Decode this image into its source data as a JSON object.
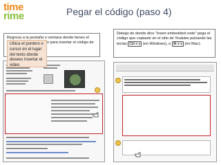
{
  "logo": {
    "line1": "time",
    "line2": "rime"
  },
  "slide": {
    "title": "Pegar el código (paso 4)"
  },
  "instructions": {
    "left": "Regresa a la pestaña o ventana donde tienes el sitio de Timerime abierto para insertar el código de Youtube,",
    "right_part1": "Debajo de donde dice “Insert embedded code” pega el código que copiaste en el sitio de Youtube pulsando las teclas",
    "right_keys_win": "Ctrl + v",
    "right_part2": "(en Windows), o",
    "right_keys_mac": "⌘ + v",
    "right_part3": "(en Mac)."
  },
  "callout": {
    "text": "Ubica el puntero o cursor en el lugar del texto donde desees insertar el video"
  },
  "badges": {
    "left": "1",
    "right_top": "2",
    "right_bottom": "3"
  },
  "colors": {
    "highlight": "#c3232c",
    "callout_bg": "#f6e3d3",
    "badge": "#f0c44c",
    "title": "#404a63"
  }
}
